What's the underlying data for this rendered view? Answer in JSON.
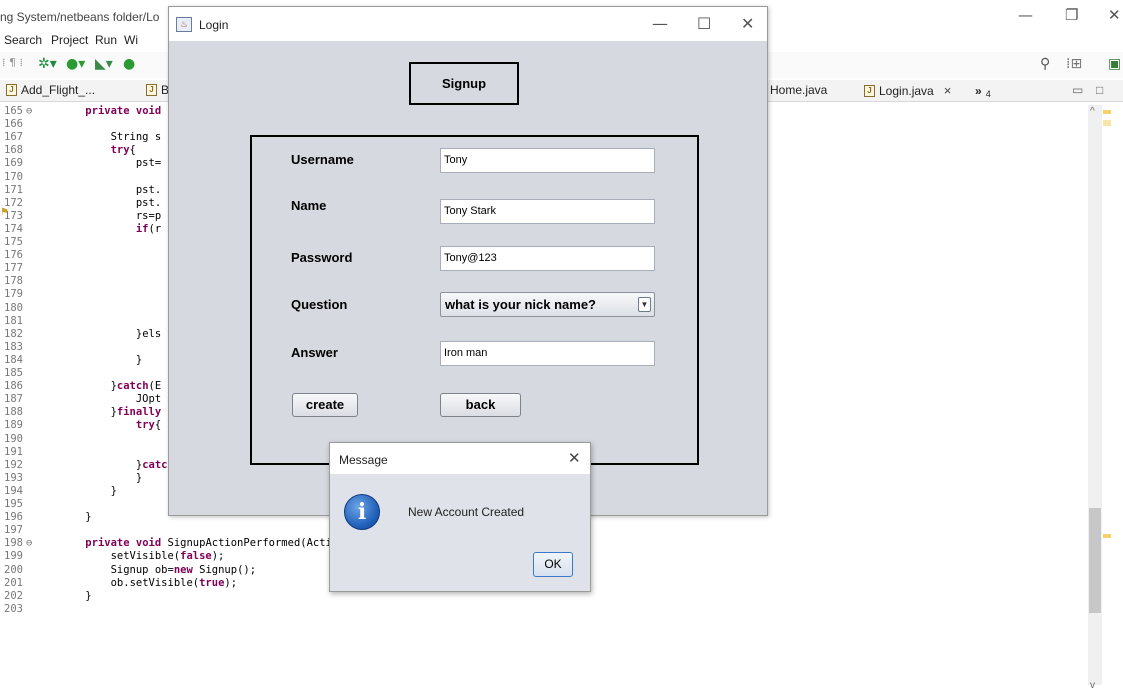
{
  "ide": {
    "title_path": "ng System/netbeans folder/Lo",
    "menu": [
      "Search",
      "Project",
      "Run",
      "Wi"
    ],
    "tabs": [
      {
        "label": "Add_Flight_...",
        "active": false
      },
      {
        "label": "B",
        "active": false
      },
      {
        "label": "Home.java",
        "active": false
      },
      {
        "label": "Login.java",
        "active": true,
        "close": "×"
      }
    ],
    "tabs_overflow": "»",
    "tabs_overflow_count": "4",
    "lines": [
      {
        "n": "165",
        "fold": "⊖",
        "code": "    private void"
      },
      {
        "n": "166",
        "code": ""
      },
      {
        "n": "167",
        "code": "        String s"
      },
      {
        "n": "168",
        "code": "        try{"
      },
      {
        "n": "169",
        "code": "            pst="
      },
      {
        "n": "170",
        "code": ""
      },
      {
        "n": "171",
        "code": "            pst."
      },
      {
        "n": "172",
        "code": "            pst."
      },
      {
        "n": "173",
        "code": "            rs=p"
      },
      {
        "n": "174",
        "code": "            if(r"
      },
      {
        "n": "175",
        "code": ""
      },
      {
        "n": "176",
        "code": ""
      },
      {
        "n": "177",
        "code": ""
      },
      {
        "n": "178",
        "code": ""
      },
      {
        "n": "179",
        "code": ""
      },
      {
        "n": "180",
        "code": ""
      },
      {
        "n": "181",
        "code": ""
      },
      {
        "n": "182",
        "code": "            }els"
      },
      {
        "n": "183",
        "code": ""
      },
      {
        "n": "184",
        "code": "            }"
      },
      {
        "n": "185",
        "code": ""
      },
      {
        "n": "186",
        "code": "        }catch(E"
      },
      {
        "n": "187",
        "code": "            JOpt"
      },
      {
        "n": "188",
        "code": "        }finally"
      },
      {
        "n": "189",
        "code": "            try{"
      },
      {
        "n": "190",
        "code": ""
      },
      {
        "n": "191",
        "code": ""
      },
      {
        "n": "192",
        "code": "            }catch(Exception e){"
      },
      {
        "n": "193",
        "code": "            }"
      },
      {
        "n": "194",
        "code": "        }"
      },
      {
        "n": "195",
        "code": ""
      },
      {
        "n": "196",
        "code": "    }"
      },
      {
        "n": "197",
        "code": ""
      },
      {
        "n": "198",
        "fold": "⊖",
        "code": "    private void SignupActionPerformed(ActionEvent evt) {"
      },
      {
        "n": "199",
        "code": "        setVisible(false);"
      },
      {
        "n": "200",
        "code": "        Signup ob=new Signup();"
      },
      {
        "n": "201",
        "code": "        ob.setVisible(true);"
      },
      {
        "n": "202",
        "code": "    }"
      },
      {
        "n": "203",
        "code": ""
      }
    ]
  },
  "login": {
    "window_title": "Login",
    "heading": "Signup",
    "labels": {
      "username": "Username",
      "name": "Name",
      "password": "Password",
      "question": "Question",
      "answer": "Answer"
    },
    "values": {
      "username": "Tony",
      "name": "Tony Stark",
      "password": "Tony@123",
      "question": "what is your nick name?",
      "answer": "Iron man"
    },
    "buttons": {
      "create": "create",
      "back": "back"
    }
  },
  "dialog": {
    "title": "Message",
    "message": "New Account Created",
    "ok": "OK",
    "icon": "i"
  },
  "colors": {
    "window_bg": "#d6d9df",
    "keyword": "#7f0055",
    "info_icon": "#1f5fb8"
  }
}
